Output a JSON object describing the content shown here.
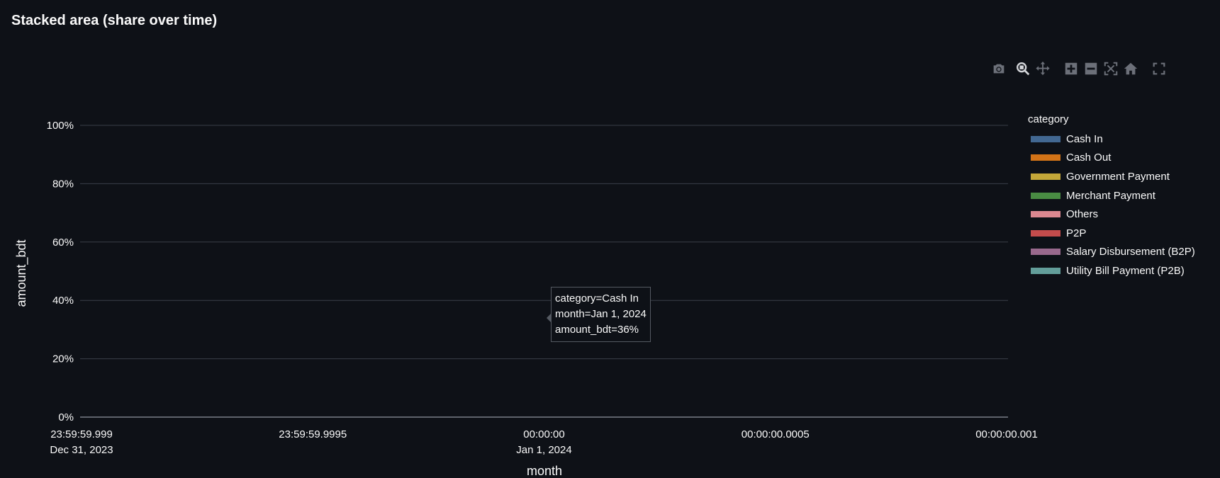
{
  "page": {
    "title": "Stacked area (share over time)"
  },
  "modebar": {
    "buttons": [
      {
        "name": "camera-icon",
        "tip": "Download plot as a png"
      },
      {
        "name": "zoom-icon",
        "tip": "Zoom"
      },
      {
        "name": "pan-icon",
        "tip": "Pan"
      },
      {
        "name": "zoom-in-icon",
        "tip": "Zoom in"
      },
      {
        "name": "zoom-out-icon",
        "tip": "Zoom out"
      },
      {
        "name": "autoscale-icon",
        "tip": "Autoscale"
      },
      {
        "name": "home-icon",
        "tip": "Reset axes"
      },
      {
        "name": "fullscreen-icon",
        "tip": "Fullscreen"
      }
    ]
  },
  "chart_data": {
    "type": "area",
    "title": "Stacked area (share over time)",
    "xlabel": "month",
    "ylabel": "amount_bdt",
    "ylim": [
      0,
      100
    ],
    "y_ticks": [
      "0%",
      "20%",
      "40%",
      "60%",
      "80%",
      "100%"
    ],
    "x_ticks": [
      {
        "line1": "23:59:59.999",
        "line2": "Dec 31, 2023"
      },
      {
        "line1": "23:59:59.9995",
        "line2": ""
      },
      {
        "line1": "00:00:00",
        "line2": "Jan 1, 2024"
      },
      {
        "line1": "00:00:00.0005",
        "line2": ""
      },
      {
        "line1": "00:00:00.001",
        "line2": ""
      }
    ],
    "grid": true,
    "legend_position": "right",
    "legend_title": "category",
    "series": [
      {
        "name": "Cash In",
        "color": "#4c78a8"
      },
      {
        "name": "Cash Out",
        "color": "#f58518"
      },
      {
        "name": "Government Payment",
        "color": "#e4c23f"
      },
      {
        "name": "Merchant Payment",
        "color": "#54a24b"
      },
      {
        "name": "Others",
        "color": "#ff9da6"
      },
      {
        "name": "P2P",
        "color": "#e45756"
      },
      {
        "name": "Salary Disbursement (B2P)",
        "color": "#b279a2"
      },
      {
        "name": "Utility Bill Payment (P2B)",
        "color": "#72b7b2"
      }
    ],
    "hover": {
      "line1": "category=Cash In",
      "line2": "month=Jan 1, 2024",
      "line3": "amount_bdt=36%"
    }
  },
  "colors": {
    "background": "#0e1117",
    "gridline": "#3a3f48",
    "text": "#fafafa",
    "icon": "#6c7079"
  }
}
